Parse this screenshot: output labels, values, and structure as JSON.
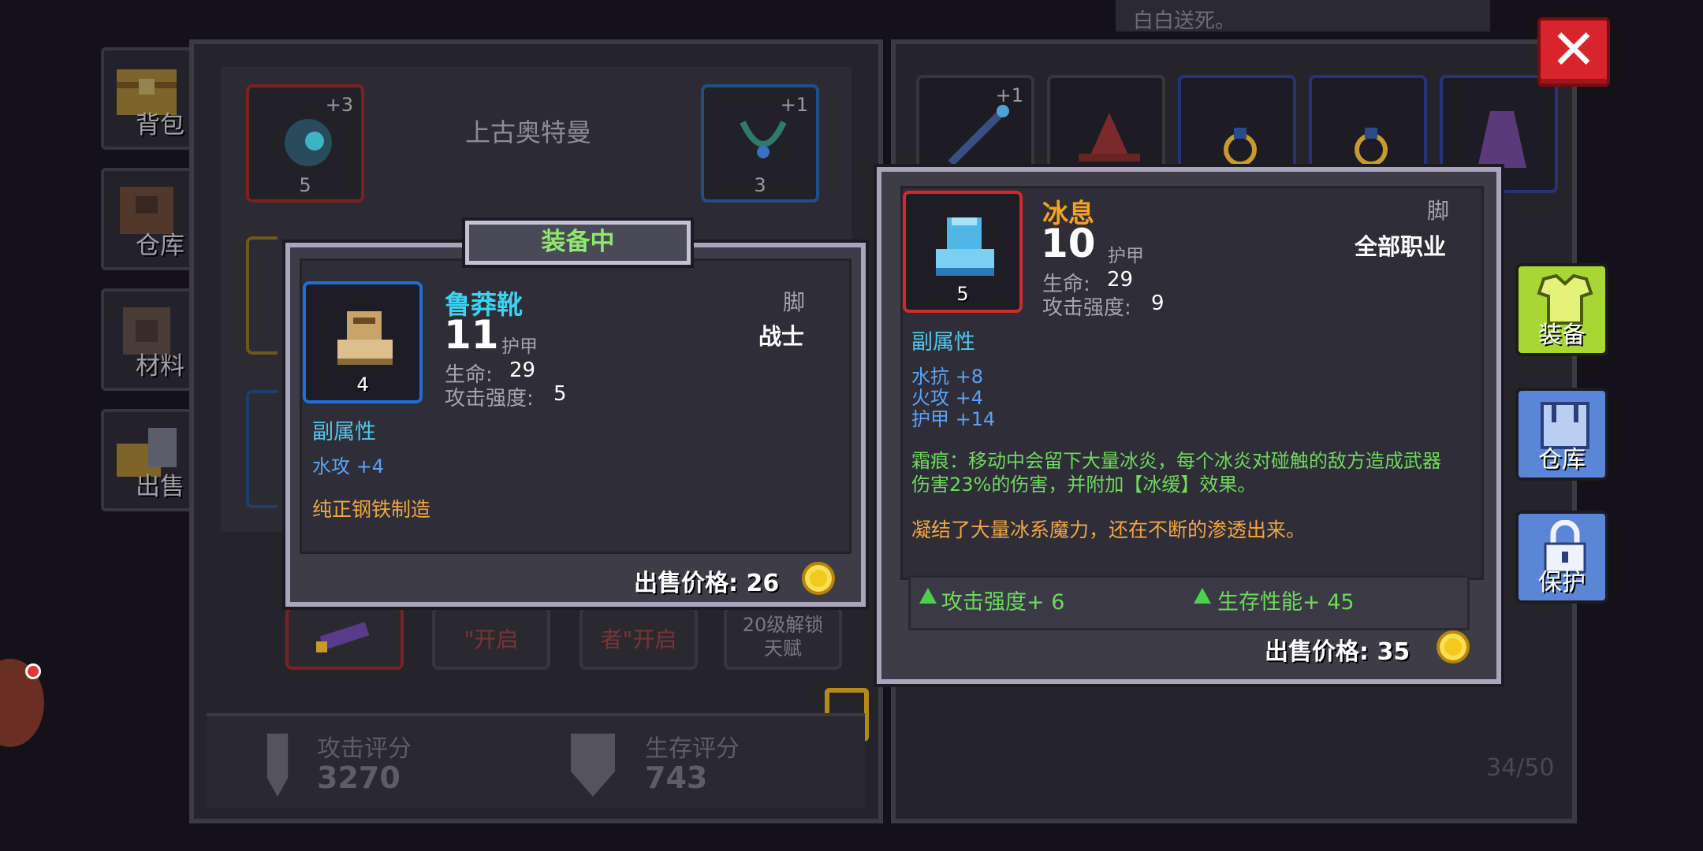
{
  "top_note": "白白送死。",
  "side_tabs": [
    {
      "label": "背包",
      "icon": "backpack-icon"
    },
    {
      "label": "仓库",
      "icon": "warehouse-icon"
    },
    {
      "label": "材料",
      "icon": "materials-icon"
    },
    {
      "label": "出售",
      "icon": "sell-icon"
    }
  ],
  "hero": {
    "name": "上古奥特曼",
    "slots": [
      {
        "level": "5",
        "plus": "+3",
        "icon": "helmet-icon"
      },
      {
        "level": "3",
        "plus": "+1",
        "icon": "necklace-icon"
      }
    ],
    "bottom_slots": [
      "\"开启",
      "者\"开启",
      "20级解锁",
      "天赋"
    ]
  },
  "scores": {
    "attack_label": "攻击评分",
    "attack_value": "3270",
    "survival_label": "生存评分",
    "survival_value": "743"
  },
  "equipped": {
    "badge": "装备中",
    "name": "鲁莽靴",
    "slot": "脚",
    "class": "战士",
    "armor_value": "11",
    "armor_label": "护甲",
    "level": "4",
    "hp_label": "生命:",
    "hp_value": "29",
    "atk_label": "攻击强度:",
    "atk_value": "5",
    "sub_title": "副属性",
    "sub_stats": [
      "水攻 +4"
    ],
    "flavor": "纯正钢铁制造",
    "price": "出售价格: 26",
    "colors": {
      "name": "#39d4f2",
      "frame": "#1f6fd6"
    }
  },
  "compare": {
    "name": "冰息",
    "slot": "脚",
    "class": "全部职业",
    "armor_value": "10",
    "armor_label": "护甲",
    "level": "5",
    "hp_label": "生命:",
    "hp_value": "29",
    "atk_label": "攻击强度:",
    "atk_value": "9",
    "sub_title": "副属性",
    "sub_stats": [
      "水抗 +8",
      "火攻 +4",
      "护甲 +14"
    ],
    "effect": "霜痕：移动中会留下大量冰炎，每个冰炎对碰触的敌方造成武器伤害23%的伤害，并附加【冰缓】效果。",
    "flavor": "凝结了大量冰系魔力，还在不断的渗透出来。",
    "diff_attack": "攻击强度+ 6",
    "diff_survival": "生存性能+ 45",
    "price": "出售价格: 35",
    "colors": {
      "name": "#f5a21e",
      "frame": "#d12a2a"
    }
  },
  "actions": [
    {
      "label": "装备",
      "icon": "armor-icon",
      "color": "#a8d634"
    },
    {
      "label": "仓库",
      "icon": "warehouse-icon",
      "color": "#5b86d8"
    },
    {
      "label": "保护",
      "icon": "lock-icon",
      "color": "#5b86d8"
    }
  ],
  "inventory_count": "34/50",
  "inventory_plus": "+1"
}
